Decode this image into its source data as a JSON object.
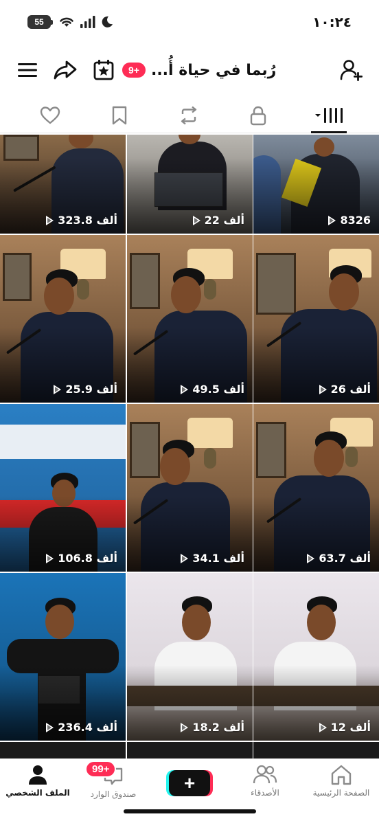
{
  "status_bar": {
    "time": "١٠:٢٤",
    "battery": "55"
  },
  "header": {
    "title": "رُبما في حياة أُ...",
    "notification_badge": "9+",
    "icons": [
      "menu-icon",
      "share-icon",
      "calendar-star-icon",
      "add-friend-icon"
    ]
  },
  "tabs": [
    {
      "name": "videos",
      "icon": "grid-icon",
      "active": true
    },
    {
      "name": "private",
      "icon": "lock-icon",
      "active": false
    },
    {
      "name": "reposts",
      "icon": "repost-icon",
      "active": false
    },
    {
      "name": "favorites",
      "icon": "bookmark-icon",
      "active": false
    },
    {
      "name": "liked",
      "icon": "heart-icon",
      "active": false
    }
  ],
  "videos": [
    {
      "views": "323.8 ألف"
    },
    {
      "views": "22 ألف"
    },
    {
      "views": "8326"
    },
    {
      "views": "25.9 ألف"
    },
    {
      "views": "49.5 ألف"
    },
    {
      "views": "26 ألف"
    },
    {
      "views": "106.8 ألف"
    },
    {
      "views": "34.1 ألف"
    },
    {
      "views": "63.7 ألف"
    },
    {
      "views": "236.4 ألف"
    },
    {
      "views": "18.2 ألف"
    },
    {
      "views": "12 ألف"
    }
  ],
  "bottom_nav": {
    "profile": "الملف الشخصي",
    "inbox": "صندوق الوارد",
    "inbox_badge": "99+",
    "create": "+",
    "friends": "الأصدقاء",
    "home": "الصفحة الرئيسية"
  },
  "colors": {
    "accent": "#fe2c55",
    "cyan": "#25f4ee",
    "text": "#111111"
  }
}
